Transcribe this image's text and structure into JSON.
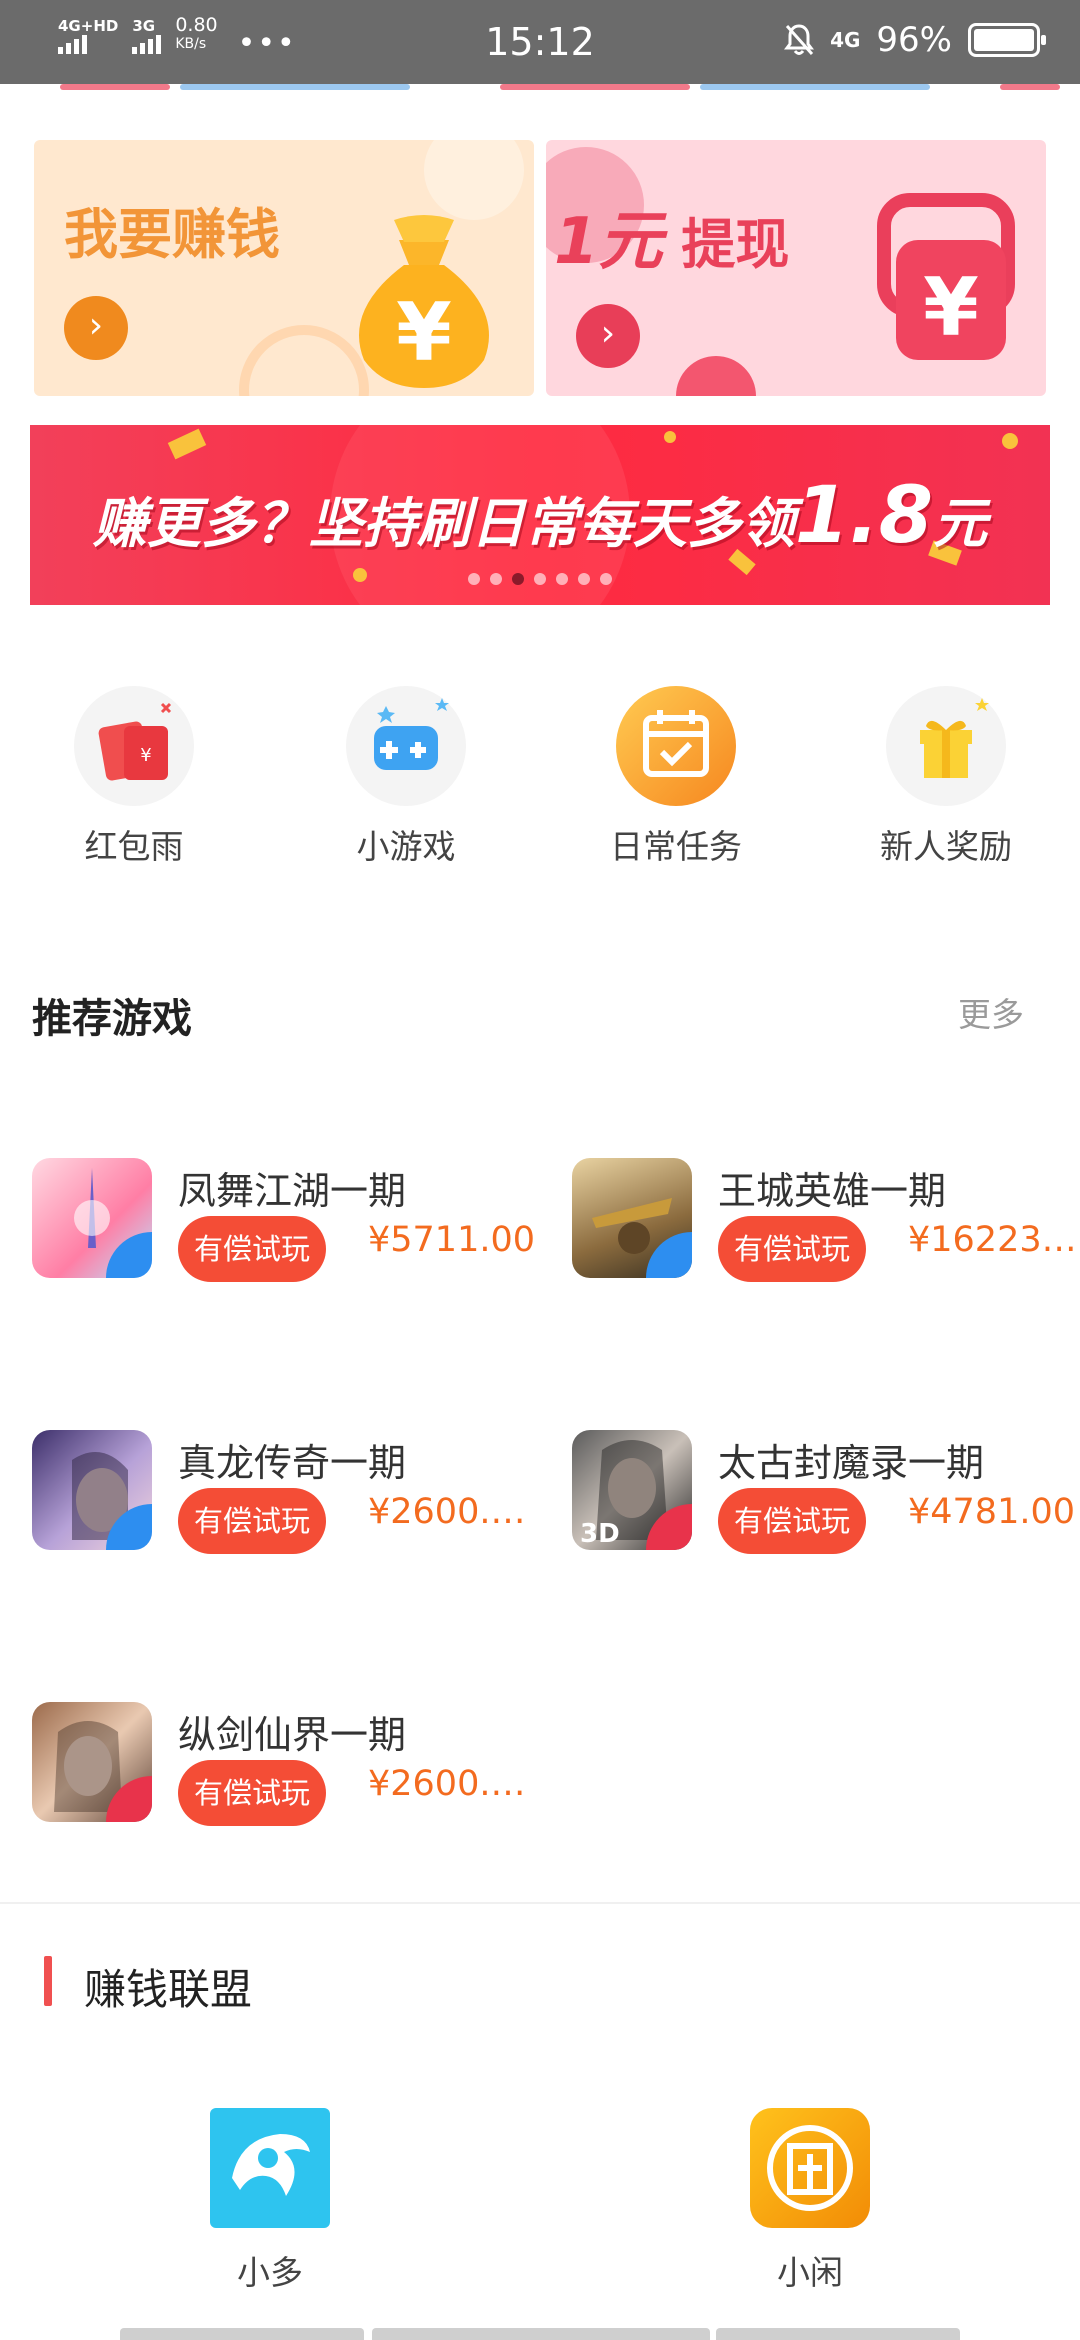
{
  "status_bar": {
    "network1": "4G+HD",
    "network2": "3G",
    "speed_value": "0.80",
    "speed_unit": "KB/s",
    "more": "•••",
    "time": "15:12",
    "network_right": "4G",
    "battery": "96%"
  },
  "promo_cards": {
    "earn": {
      "title": "我要赚钱",
      "arrow": "›"
    },
    "withdraw": {
      "title_num": "1元",
      "title_text": "提现",
      "arrow": "›"
    }
  },
  "banner": {
    "text": "赚更多？坚持刷日常每天多领",
    "amount": "1.8",
    "unit": "元",
    "slide_count": 7,
    "active_slide": 3
  },
  "quick_actions": [
    {
      "label": "红包雨",
      "icon": "red-envelope-icon"
    },
    {
      "label": "小游戏",
      "icon": "gamepad-icon"
    },
    {
      "label": "日常任务",
      "icon": "calendar-check-icon"
    },
    {
      "label": "新人奖励",
      "icon": "gift-icon"
    }
  ],
  "recommended": {
    "title": "推荐游戏",
    "more": "更多",
    "games": [
      {
        "name": "凤舞江湖一期",
        "tag": "有偿试玩",
        "price": "¥5711.00"
      },
      {
        "name": "王城英雄一期",
        "tag": "有偿试玩",
        "price": "¥16223…"
      },
      {
        "name": "真龙传奇一期",
        "tag": "有偿试玩",
        "price": "¥2600.…"
      },
      {
        "name": "太古封魔录一期",
        "tag": "有偿试玩",
        "price": "¥4781.00"
      },
      {
        "name": "纵剑仙界一期",
        "tag": "有偿试玩",
        "price": "¥2600.…"
      }
    ]
  },
  "alliance": {
    "title": "赚钱联盟",
    "apps": [
      {
        "label": "小多",
        "color": "#2ec4ef"
      },
      {
        "label": "小闲",
        "color": "#f5a00c"
      }
    ]
  },
  "colors": {
    "accent": "#f44d36",
    "price": "#f36b1f",
    "banner": "#f2405a"
  }
}
